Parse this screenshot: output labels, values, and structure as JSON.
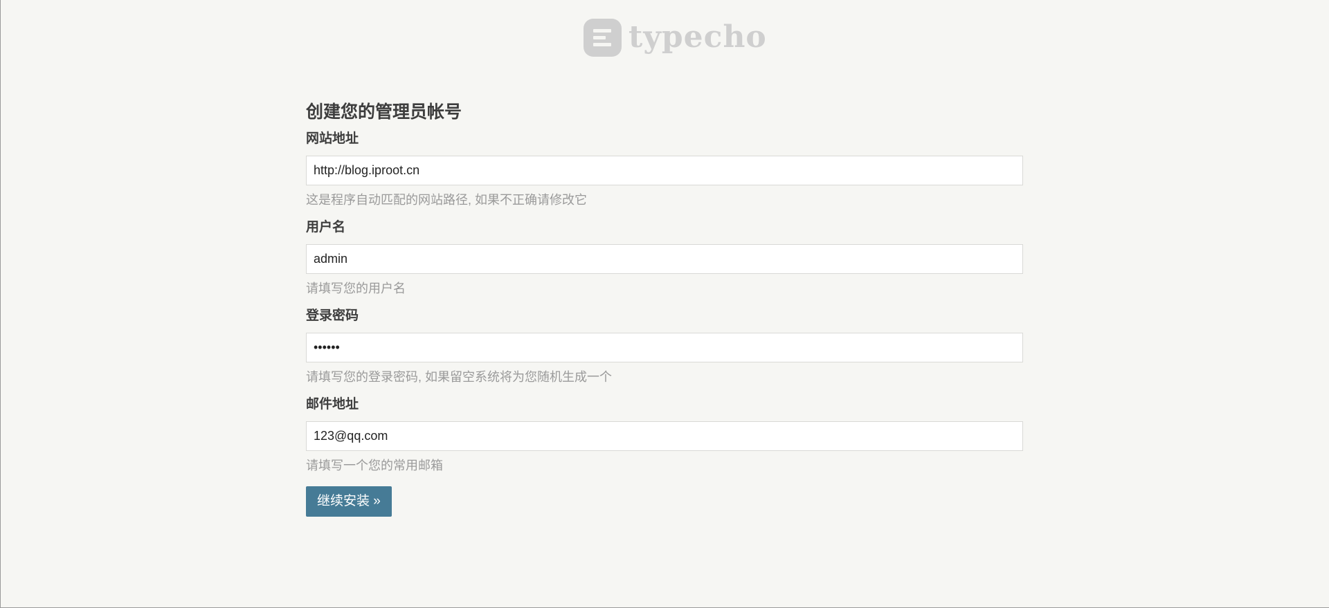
{
  "brand": {
    "logo_text": "typecho",
    "logo_color": "#cfcfcf"
  },
  "form": {
    "title": "创建您的管理员帐号",
    "fields": [
      {
        "label": "网站地址",
        "value": "http://blog.iproot.cn",
        "type": "text",
        "hint": "这是程序自动匹配的网站路径, 如果不正确请修改它"
      },
      {
        "label": "用户名",
        "value": "admin",
        "type": "text",
        "hint": "请填写您的用户名"
      },
      {
        "label": "登录密码",
        "value": "••••••",
        "type": "password",
        "hint": "请填写您的登录密码, 如果留空系统将为您随机生成一个"
      },
      {
        "label": "邮件地址",
        "value": "123@qq.com",
        "type": "text",
        "hint": "请填写一个您的常用邮箱"
      }
    ],
    "submit_label": "继续安装 »"
  },
  "colors": {
    "background": "#f6f6f3",
    "button": "#467b96",
    "hint": "#9a9a9a"
  }
}
